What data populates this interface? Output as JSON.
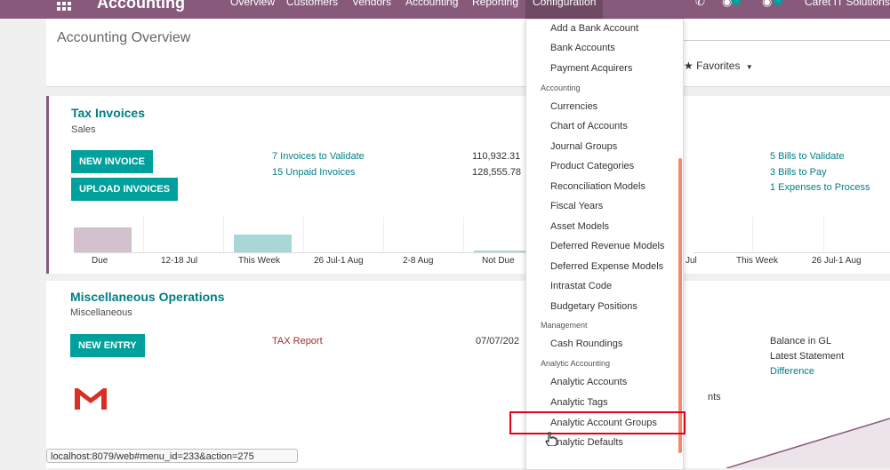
{
  "topbar": {
    "app_title": "Accounting",
    "nav": [
      "Overview",
      "Customers",
      "Vendors",
      "Accounting",
      "Reporting",
      "Configuration"
    ],
    "company": "Caret IT Solutions",
    "colors": {
      "primary": "#875a7b",
      "accent": "#00a09d"
    }
  },
  "control": {
    "breadcrumb": "Accounting Overview",
    "favorites": "Favorites"
  },
  "sales_card": {
    "title": "Tax Invoices",
    "subtitle": "Sales",
    "new_button": "NEW INVOICE",
    "upload_button": "UPLOAD INVOICES",
    "links": [
      "7 Invoices to Validate",
      "15 Unpaid Invoices"
    ],
    "amounts": [
      "110,932.31",
      "128,555.78"
    ],
    "vendor_links": [
      "5 Bills to Validate",
      "3 Bills to Pay",
      "1 Expenses to Process"
    ],
    "graph_labels": [
      "Due",
      "12-18 Jul",
      "This Week",
      "26 Jul-1 Aug",
      "2-8 Aug",
      "Not Due"
    ],
    "graph2_labels": [
      "Jul",
      "This Week",
      "26 Jul-1 Aug"
    ]
  },
  "misc_card": {
    "title": "Miscellaneous Operations",
    "subtitle": "Miscellaneous",
    "new_button": "NEW ENTRY",
    "tax_report": "TAX Report",
    "date": "07/07/202",
    "right": [
      "Balance in GL",
      "Latest Statement"
    ],
    "difference": "Difference",
    "partial": "nts"
  },
  "menu": {
    "items": [
      {
        "type": "item",
        "label": "Add a Bank Account"
      },
      {
        "type": "item",
        "label": "Bank Accounts"
      },
      {
        "type": "item",
        "label": "Payment Acquirers"
      },
      {
        "type": "header",
        "label": "Accounting"
      },
      {
        "type": "item",
        "label": "Currencies"
      },
      {
        "type": "item",
        "label": "Chart of Accounts"
      },
      {
        "type": "item",
        "label": "Journal Groups"
      },
      {
        "type": "item",
        "label": "Product Categories"
      },
      {
        "type": "item",
        "label": "Reconciliation Models"
      },
      {
        "type": "item",
        "label": "Fiscal Years"
      },
      {
        "type": "item",
        "label": "Asset Models"
      },
      {
        "type": "item",
        "label": "Deferred Revenue Models"
      },
      {
        "type": "item",
        "label": "Deferred Expense Models"
      },
      {
        "type": "item",
        "label": "Intrastat Code"
      },
      {
        "type": "item",
        "label": "Budgetary Positions"
      },
      {
        "type": "header",
        "label": "Management"
      },
      {
        "type": "item",
        "label": "Cash Roundings"
      },
      {
        "type": "header",
        "label": "Analytic Accounting"
      },
      {
        "type": "item",
        "label": "Analytic Accounts"
      },
      {
        "type": "item",
        "label": "Analytic Tags"
      },
      {
        "type": "item",
        "label": "Analytic Account Groups"
      },
      {
        "type": "item",
        "label": "Analytic Defaults"
      }
    ]
  },
  "status_url": "localhost:8079/web#menu_id=233&action=275"
}
